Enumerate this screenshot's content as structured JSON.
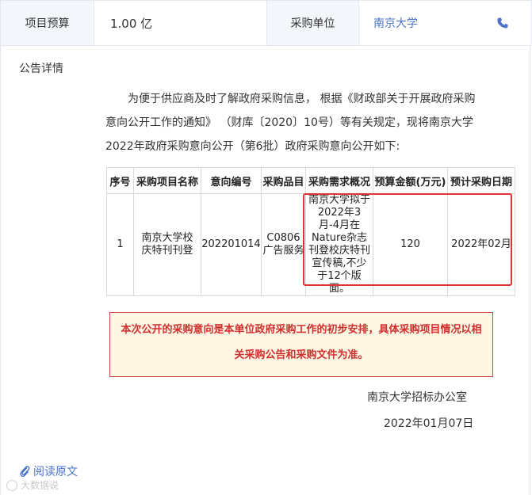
{
  "header": {
    "budget_label": "项目预算",
    "budget_value": "1.00 亿",
    "unit_label": "采购单位",
    "unit_value": "南京大学"
  },
  "section_title": "公告详情",
  "intro": {
    "line1": "为便于供应商及时了解政府采购信息， 根据《财政部关于开展政府采购",
    "line2": "意向公开工作的通知》 （财库〔2020〕10号）等有关规定，现将南京大学",
    "line3": "2022年政府采购意向公开（第6批）政府采购意向公开如下:"
  },
  "table": {
    "headers": [
      "序号",
      "采购项目名称",
      "意向编号",
      "采购品目",
      "采购需求概况",
      "预算金额(万元)",
      "预计采购日期"
    ],
    "row": {
      "index": "1",
      "project_name": "南京大学校庆特刊刊登",
      "intent_no": "202201014",
      "category_code": "C0806",
      "category_name": "广告服务",
      "demand": "南京大学拟于2022年3月-4月在Nature杂志刊登校庆特刊宣传稿,不少于12个版面。",
      "budget": "120",
      "date": "2022年02月"
    }
  },
  "notice": "本次公开的采购意向是本单位政府采购工作的初步安排，具体采购项目情况以相关采购公告和采购文件为准。",
  "signature": {
    "org": "南京大学招标办公室",
    "date": "2022年01月07日"
  },
  "read_original": "阅读原文",
  "watermark": "大数据说",
  "colors": {
    "accent": "#4a73c9",
    "highlight": "#e23232",
    "notice_bg": "#fdf7e3"
  },
  "icons": {
    "phone": "phone-icon",
    "attachment": "paperclip-icon"
  }
}
